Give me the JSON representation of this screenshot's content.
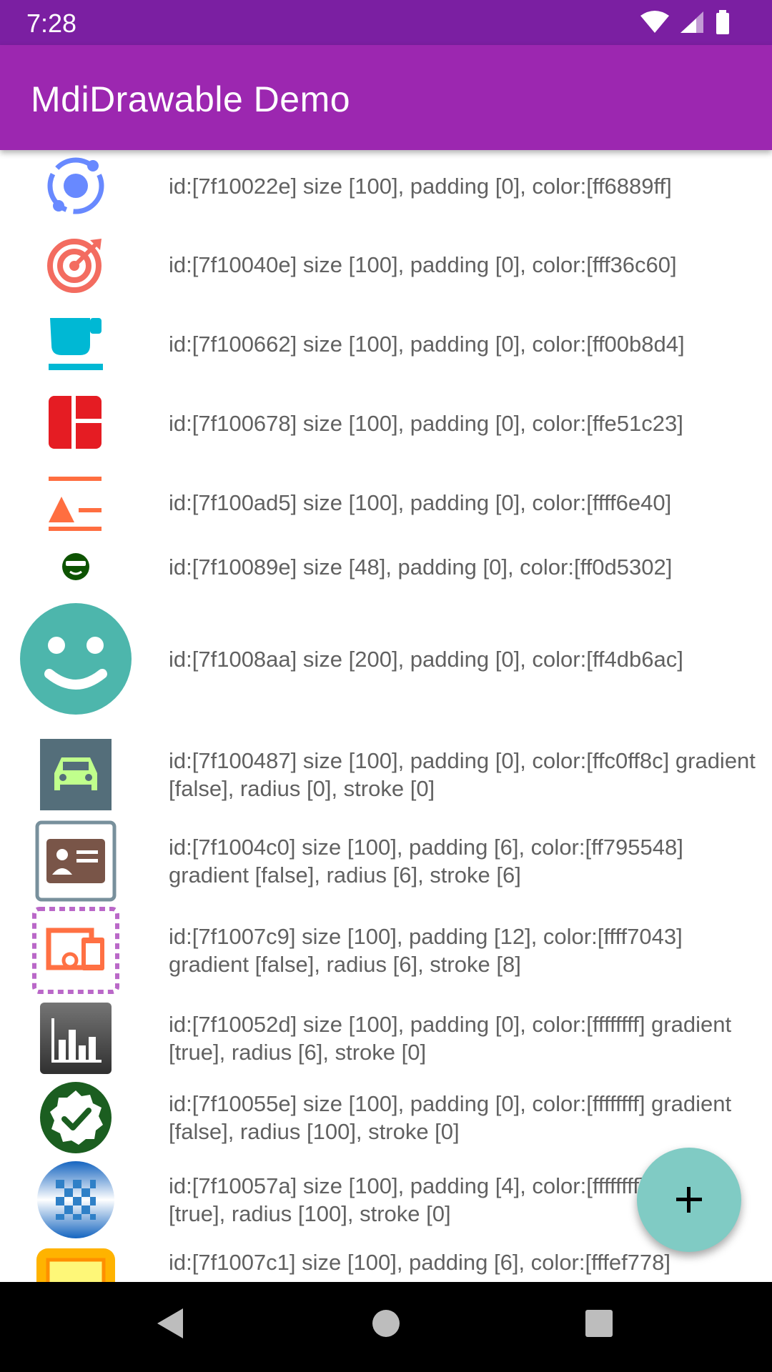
{
  "status_bar": {
    "time": "7:28",
    "icons": [
      "wifi-icon",
      "cellular-icon",
      "battery-icon"
    ]
  },
  "app_bar": {
    "title": "MdiDrawable Demo",
    "color": "#9c27b0",
    "status_color": "#7b1fa2"
  },
  "list": {
    "items": [
      {
        "icon": "orbit-icon",
        "color": "#6889ff",
        "text": "id:[7f10022e] size [100], padding [0], color:[ff6889ff]"
      },
      {
        "icon": "target-arrow-icon",
        "color": "#f36c60",
        "text": "id:[7f10040e] size [100], padding [0], color:[fff36c60]"
      },
      {
        "icon": "coffee-cup-icon",
        "color": "#00b8d4",
        "text": "id:[7f100662] size [100], padding [0], color:[ff00b8d4]"
      },
      {
        "icon": "dashboard-layout-icon",
        "color": "#e51c23",
        "text": "id:[7f100678] size [100], padding [0], color:[ffe51c23]"
      },
      {
        "icon": "format-shape-text-icon",
        "color": "#ff6e40",
        "text": "id:[7f100ad5] size [100], padding [0], color:[ffff6e40]"
      },
      {
        "icon": "incognito-face-icon",
        "color": "#0d5302",
        "text": "id:[7f10089e] size [48], padding [0], color:[ff0d5302]"
      },
      {
        "icon": "smiley-face-icon",
        "color": "#4db6ac",
        "text": "id:[7f1008aa] size [200], padding [0], color:[ff4db6ac]"
      },
      {
        "icon": "car-icon",
        "color": "#c0ff8c",
        "text": "id:[7f100487] size [100], padding [0], color:[ffc0ff8c] gradient [false], radius [0], stroke [0]"
      },
      {
        "icon": "contact-card-icon",
        "color": "#795548",
        "text": "id:[7f1004c0] size [100], padding [6], color:[ff795548] gradient [false], radius [6], stroke [6]"
      },
      {
        "icon": "devices-icon",
        "color": "#ff7043",
        "text": "id:[7f1007c9] size [100], padding [12], color:[ffff7043] gradient [false], radius [6], stroke [8]"
      },
      {
        "icon": "bar-chart-icon",
        "color": "#ffffff",
        "text": "id:[7f10052d] size [100], padding [0], color:[ffffffff] gradient [true], radius [6], stroke [0]"
      },
      {
        "icon": "verified-check-icon",
        "color": "#ffffff",
        "text": "id:[7f10055e] size [100], padding [0], color:[ffffffff] gradient [false], radius [100], stroke [0]"
      },
      {
        "icon": "checkerboard-icon",
        "color": "#ffffff",
        "text": "id:[7f10057a] size [100], padding [4], color:[ffffffff] gradient [true], radius [100], stroke [0]"
      },
      {
        "icon": "tablet-frame-icon",
        "color": "#fef778",
        "text": "id:[7f1007c1] size [100], padding [6], color:[fffef778]"
      }
    ]
  },
  "fab": {
    "icon": "plus-icon",
    "color": "#80cbc4"
  },
  "nav_bar": {
    "icons": [
      "back-icon",
      "home-icon",
      "recents-icon"
    ]
  }
}
